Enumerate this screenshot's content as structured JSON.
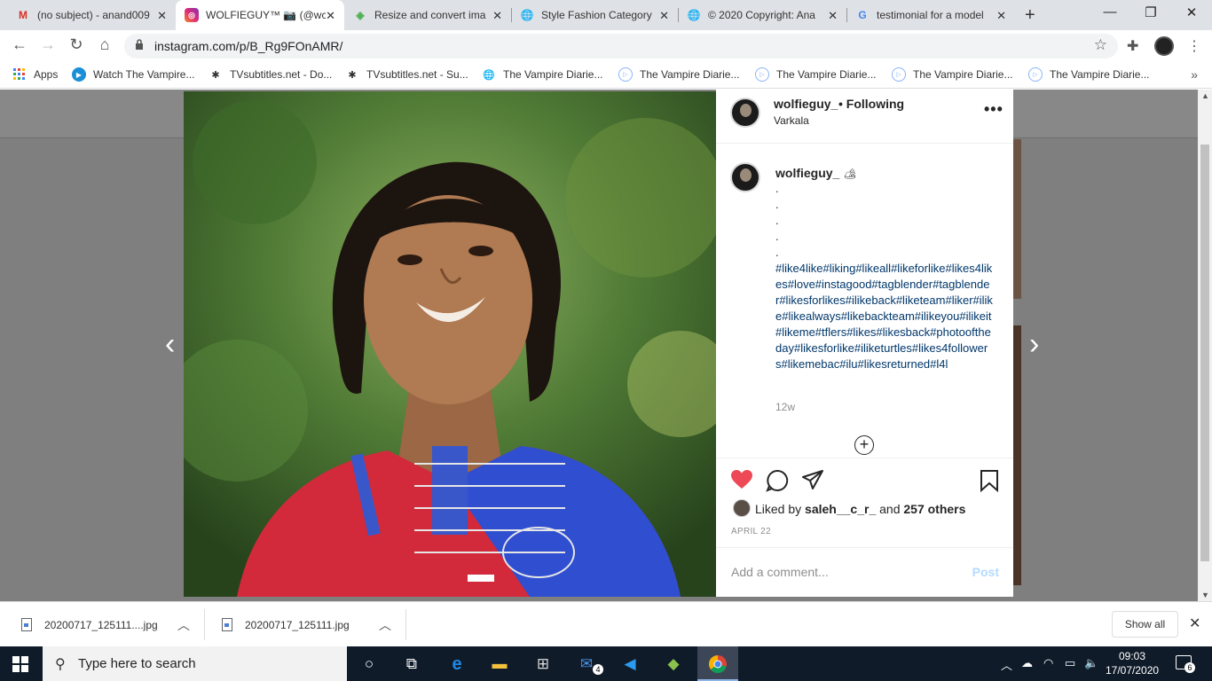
{
  "browser": {
    "tabs": [
      {
        "label": "(no subject) - anand009",
        "icon": "gmail-icon"
      },
      {
        "label": "WOLFIEGUY™ 📷 (@wc",
        "icon": "instagram-icon"
      },
      {
        "label": "Resize and convert ima",
        "icon": "resize-app-icon"
      },
      {
        "label": "Style Fashion Category",
        "icon": "globe-icon"
      },
      {
        "label": "© 2020 Copyright: Ana",
        "icon": "globe-icon"
      },
      {
        "label": "testimonial for a model",
        "icon": "google-icon"
      }
    ],
    "url": "instagram.com/p/B_Rg9FOnAMR/"
  },
  "bookmarks": [
    {
      "label": "Apps",
      "icon": "apps-grid-icon"
    },
    {
      "label": "Watch The Vampire...",
      "icon": "play-circle-icon"
    },
    {
      "label": "TVsubtitles.net - Do...",
      "icon": "tvsubtitles-icon"
    },
    {
      "label": "TVsubtitles.net - Su...",
      "icon": "tvsubtitles-icon"
    },
    {
      "label": "The Vampire Diarie...",
      "icon": "globe-icon"
    },
    {
      "label": "The Vampire Diarie...",
      "icon": "play-outline-icon"
    },
    {
      "label": "The Vampire Diarie...",
      "icon": "play-outline-icon"
    },
    {
      "label": "The Vampire Diarie...",
      "icon": "play-outline-icon"
    },
    {
      "label": "The Vampire Diarie...",
      "icon": "play-outline-icon"
    }
  ],
  "post": {
    "username": "wolfieguy_",
    "following": "• Following",
    "location": "Varkala",
    "caption_user": "wolfieguy_",
    "caption_emoji": "🏕",
    "dots": [
      ".",
      ".",
      ".",
      ".",
      "."
    ],
    "hashtags": "#like4like#liking#likeall#likeforlike#likes4likes#love#instagood#tagblender#tagblender#likesforlikes#ilikeback#liketeam#liker#ilike#likealways#likebackteam#ilikeyou#ilikeit#likeme#tflers#likes#likesback#photooftheday#likesforlike#iliketurtles#likes4followers#likemebac#ilu#likesreturned#l4l",
    "age": "12w",
    "liked_prefix": "Liked by",
    "liked_user": "saleh__c_r_",
    "liked_and": "and",
    "liked_others": "257 others",
    "date": "APRIL 22",
    "comment_placeholder": "Add a comment...",
    "post_button": "Post"
  },
  "downloads": [
    {
      "label": "20200717_125111....jpg"
    },
    {
      "label": "20200717_125111.jpg"
    }
  ],
  "show_all": "Show all",
  "taskbar": {
    "search_placeholder": "Type here to search",
    "mail_badge": "4",
    "time": "09:03",
    "date": "17/07/2020",
    "notification_count": "6"
  },
  "colors": {
    "like_red": "#ed4956",
    "hashtag_blue": "#00376b",
    "post_disabled": "#b3dbff"
  }
}
